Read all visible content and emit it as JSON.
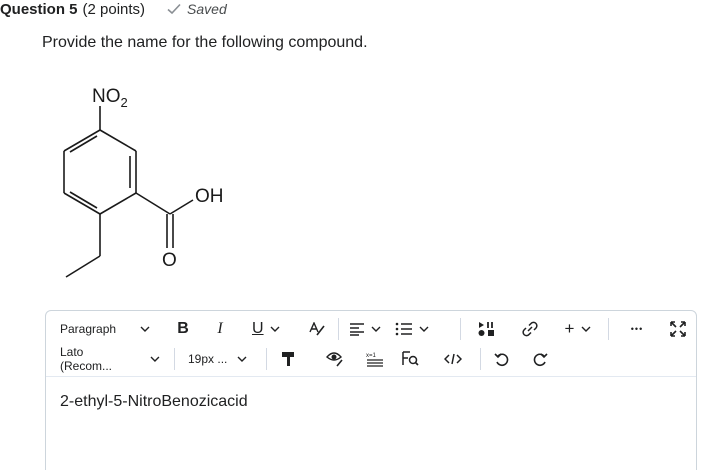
{
  "question": {
    "title": "Question 5",
    "points": "(2 points)",
    "saved_label": "Saved",
    "prompt": "Provide the name for the following compound."
  },
  "structure": {
    "labels": {
      "nitro": "NO",
      "nitro_sub": "2",
      "hydroxyl": "OH",
      "carbonyl_o": "O"
    }
  },
  "editor": {
    "block_format": "Paragraph",
    "font_family": "Lato (Recom...",
    "font_size": "19px ...",
    "bold_label": "B",
    "italic_label": "I",
    "underline_label": "U",
    "add_label": "+",
    "more_label": "•••",
    "answer_text": "2-ethyl-5-NitroBenozicacid"
  },
  "icons": [
    "check-icon",
    "chevron-down-icon",
    "text-color-icon",
    "align-icon",
    "list-icon",
    "media-icon",
    "link-icon",
    "more-icon",
    "fullscreen-icon",
    "format-painter-icon",
    "accessibility-icon",
    "equation-icon",
    "find-replace-icon",
    "source-code-icon",
    "undo-icon",
    "redo-icon"
  ]
}
